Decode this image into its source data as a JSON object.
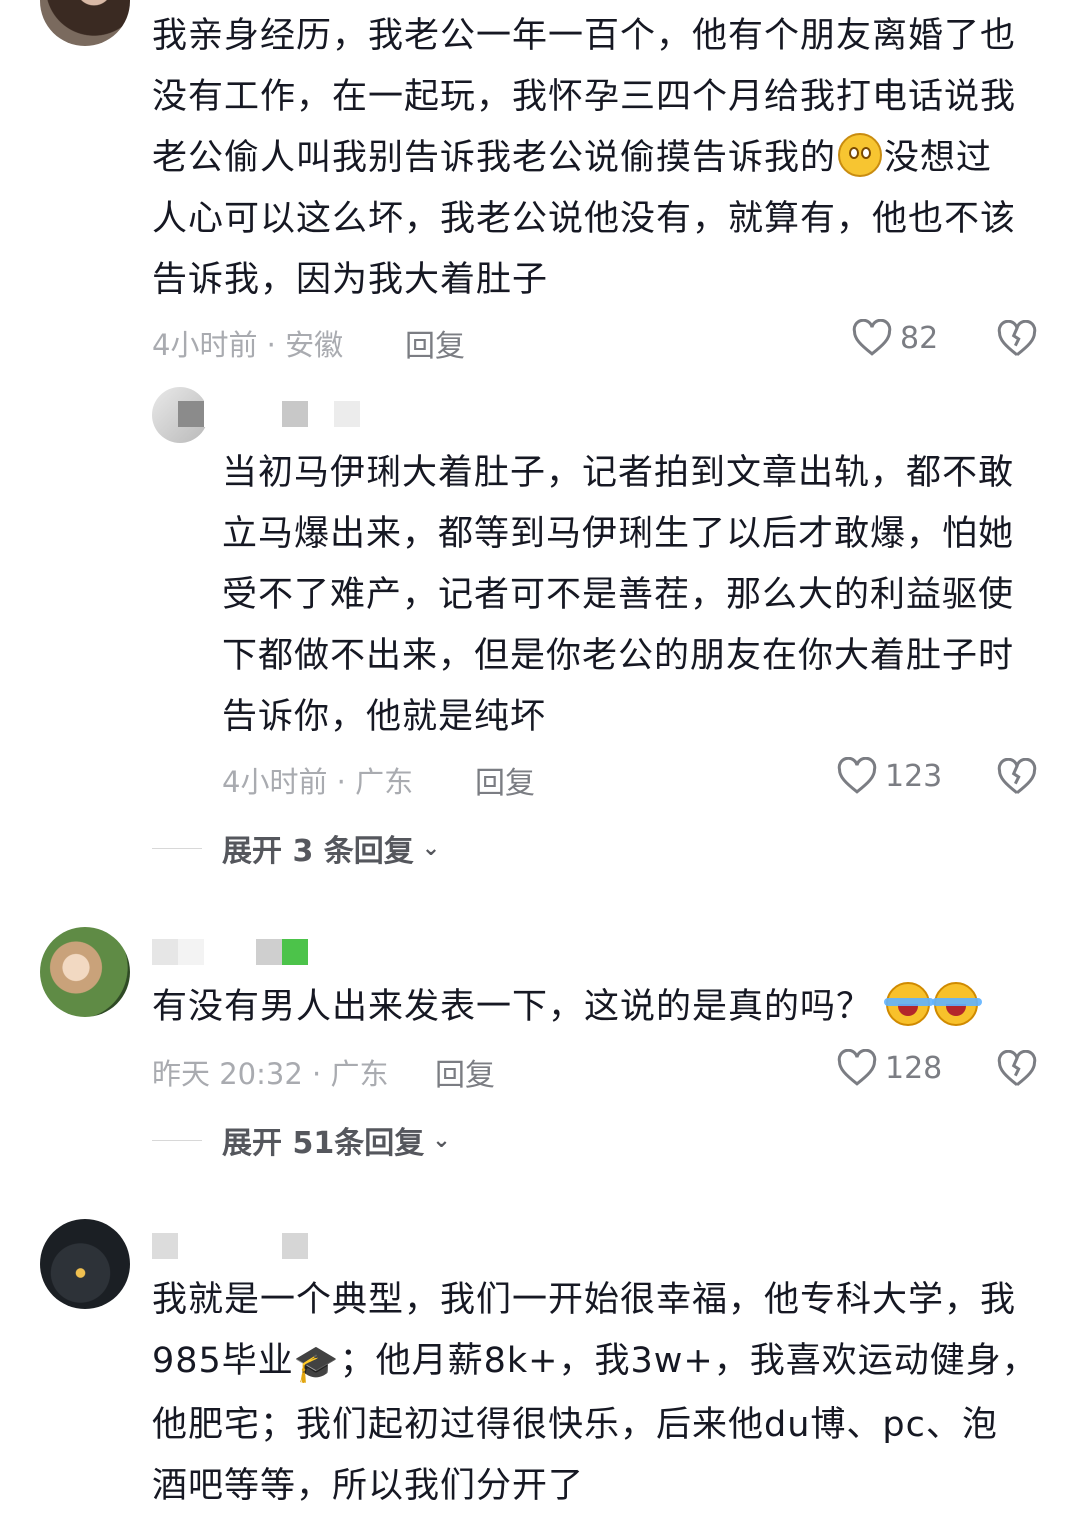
{
  "colors": {
    "text": "#161823",
    "meta": "#a9abb0",
    "action": "#7b7d83",
    "expand": "#55575d",
    "mosaic_green": "#4cc34a"
  },
  "comments": [
    {
      "text_lines": [
        "我亲身经历，我老公一年一百个，他有个朋友离婚了也",
        "没有工作，在一起玩，我怀孕三四个月给我打电话说我",
        "老公偷人叫我别告诉我老公说偷摸告诉我的",
        "没想过",
        "人心可以这么坏，我老公说他没有，就算有，他也不该",
        "告诉我，因为我大着肚子"
      ],
      "emoji_inline": "smile-emoji",
      "time_location": "4小时前 · 安徽",
      "reply_label": "回复",
      "likes": "82"
    },
    {
      "text_lines": [
        "当初马伊琍大着肚子，记者拍到文章出轨，都不敢",
        "立马爆出来，都等到马伊琍生了以后才敢爆，怕她",
        "受不了难产，记者可不是善茬，那么大的利益驱使",
        "下都做不出来，但是你老公的朋友在你大着肚子时",
        "告诉你，他就是纯坏"
      ],
      "time_location": "4小时前 · 广东",
      "reply_label": "回复",
      "likes": "123",
      "expand_label": "展开 3 条回复"
    },
    {
      "text_lines": [
        "有没有男人出来发表一下，这说的是真的吗？"
      ],
      "emoji_inline": "cry-laugh-emoji",
      "time_location": "昨天 20:32 · 广东",
      "reply_label": "回复",
      "likes": "128",
      "expand_label": "展开 51条回复"
    },
    {
      "text_lines": [
        "我就是一个典型，我们一开始很幸福，他专科大学，我",
        "985毕业",
        "；他月薪8k+，我3w+，我喜欢运动健身，",
        "他肥宅；我们起初过得很快乐，后来他du博、pc、泡",
        "酒吧等等，所以我们分开了"
      ],
      "emoji_inline": "graduation-cap-emoji"
    }
  ]
}
